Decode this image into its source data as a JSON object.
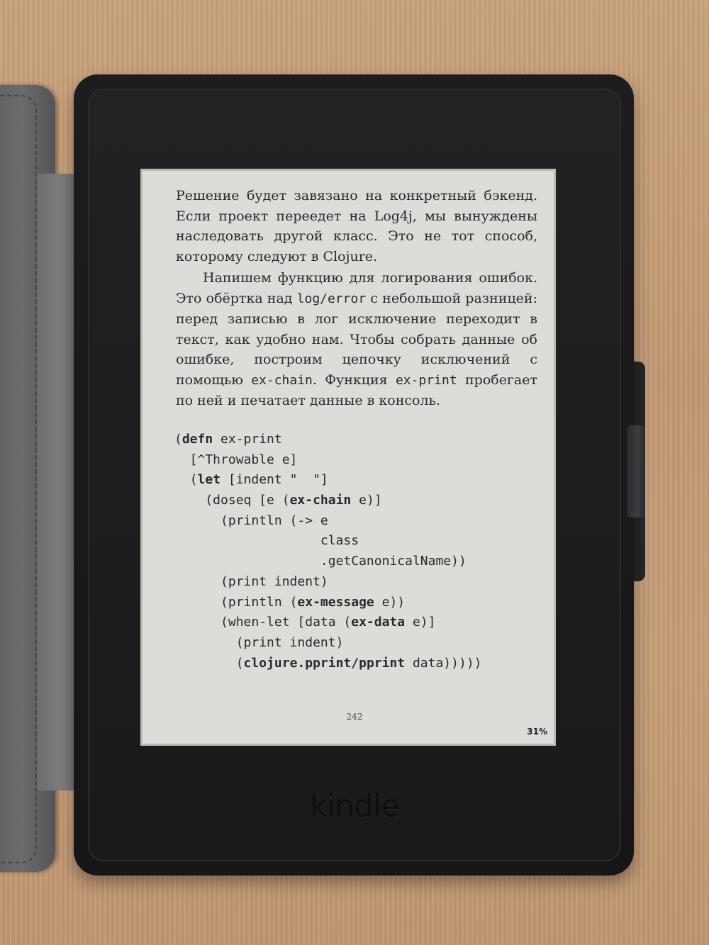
{
  "book_page": {
    "paragraph1": "Решение будет завязано на конкретный бэкенд. Если проект переедет на Log4j, мы вынуждены наследовать другой класс. Это не тот способ, которому следуют в Clojure.",
    "paragraph2": {
      "part1": "Напишем функцию для логирования ошибок. Это обёртка над ",
      "code1": "log/error",
      "part2": " с небольшой разницей: перед записью в лог исключение переходит в текст, как удобно нам. Чтобы собрать данные об ошибке, построим цепочку исключений с помощью ",
      "code2": "ex-chain",
      "part3": ". Функция ",
      "code3": "ex-print",
      "part4": " пробегает по ней и печатает данные в консоль."
    },
    "code_lines": [
      {
        "pre": "(",
        "kw": "defn",
        "post": " ex-print"
      },
      {
        "pre": "  [^Throwable e]",
        "kw": "",
        "post": ""
      },
      {
        "pre": "  (",
        "kw": "let",
        "post": " [indent \"  \"]"
      },
      {
        "pre": "    (doseq [e (",
        "kw": "ex-chain",
        "post": " e)]"
      },
      {
        "pre": "      (println (-> e",
        "kw": "",
        "post": ""
      },
      {
        "pre": "                   class",
        "kw": "",
        "post": ""
      },
      {
        "pre": "                   .getCanonicalName))",
        "kw": "",
        "post": ""
      },
      {
        "pre": "      (print indent)",
        "kw": "",
        "post": ""
      },
      {
        "pre": "      (println (",
        "kw": "ex-message",
        "post": " e))"
      },
      {
        "pre": "      (when-let [data (",
        "kw": "ex-data",
        "post": " e)]"
      },
      {
        "pre": "        (print indent)",
        "kw": "",
        "post": ""
      },
      {
        "pre": "        (",
        "kw": "clojure.pprint/pprint",
        "post": " data)))))"
      }
    ],
    "page_number": "242",
    "progress_percent": "31%"
  },
  "device": {
    "brand": "kindle",
    "colors": {
      "shell": "#1a1a1b",
      "screen": "#dcdcd9",
      "table_wood": "#c59d78",
      "case_cover": "#5a5a5d"
    }
  }
}
